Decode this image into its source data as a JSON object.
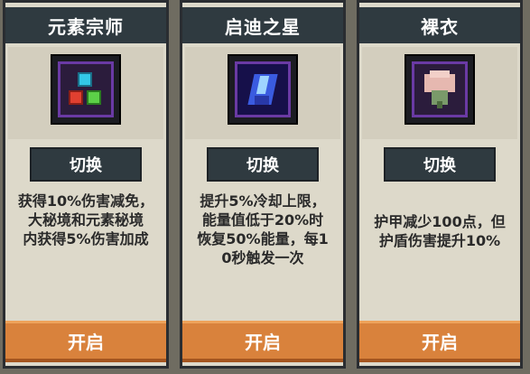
{
  "cards": [
    {
      "title": "元素宗师",
      "icon": "elemental-orbs-icon",
      "switch_label": "切换",
      "description": "获得10%伤害减免，\n大秘境和元素秘境\n内获得5%伤害加成",
      "open_label": "开启"
    },
    {
      "title": "启迪之星",
      "icon": "blue-crystal-icon",
      "switch_label": "切换",
      "description": "提升5%冷却上限，\n能量值低于20%时\n恢复50%能量，每1\n0秒触发一次",
      "open_label": "开启"
    },
    {
      "title": "裸衣",
      "icon": "pink-flower-icon",
      "switch_label": "切换",
      "description": "护甲减少100点，但\n护盾伤害提升10%",
      "open_label": "开启"
    }
  ],
  "colors": {
    "header": "#2f3a40",
    "card_bg": "#ddd9ca",
    "open_button": "#d9823c",
    "background": "#6f6c61"
  }
}
